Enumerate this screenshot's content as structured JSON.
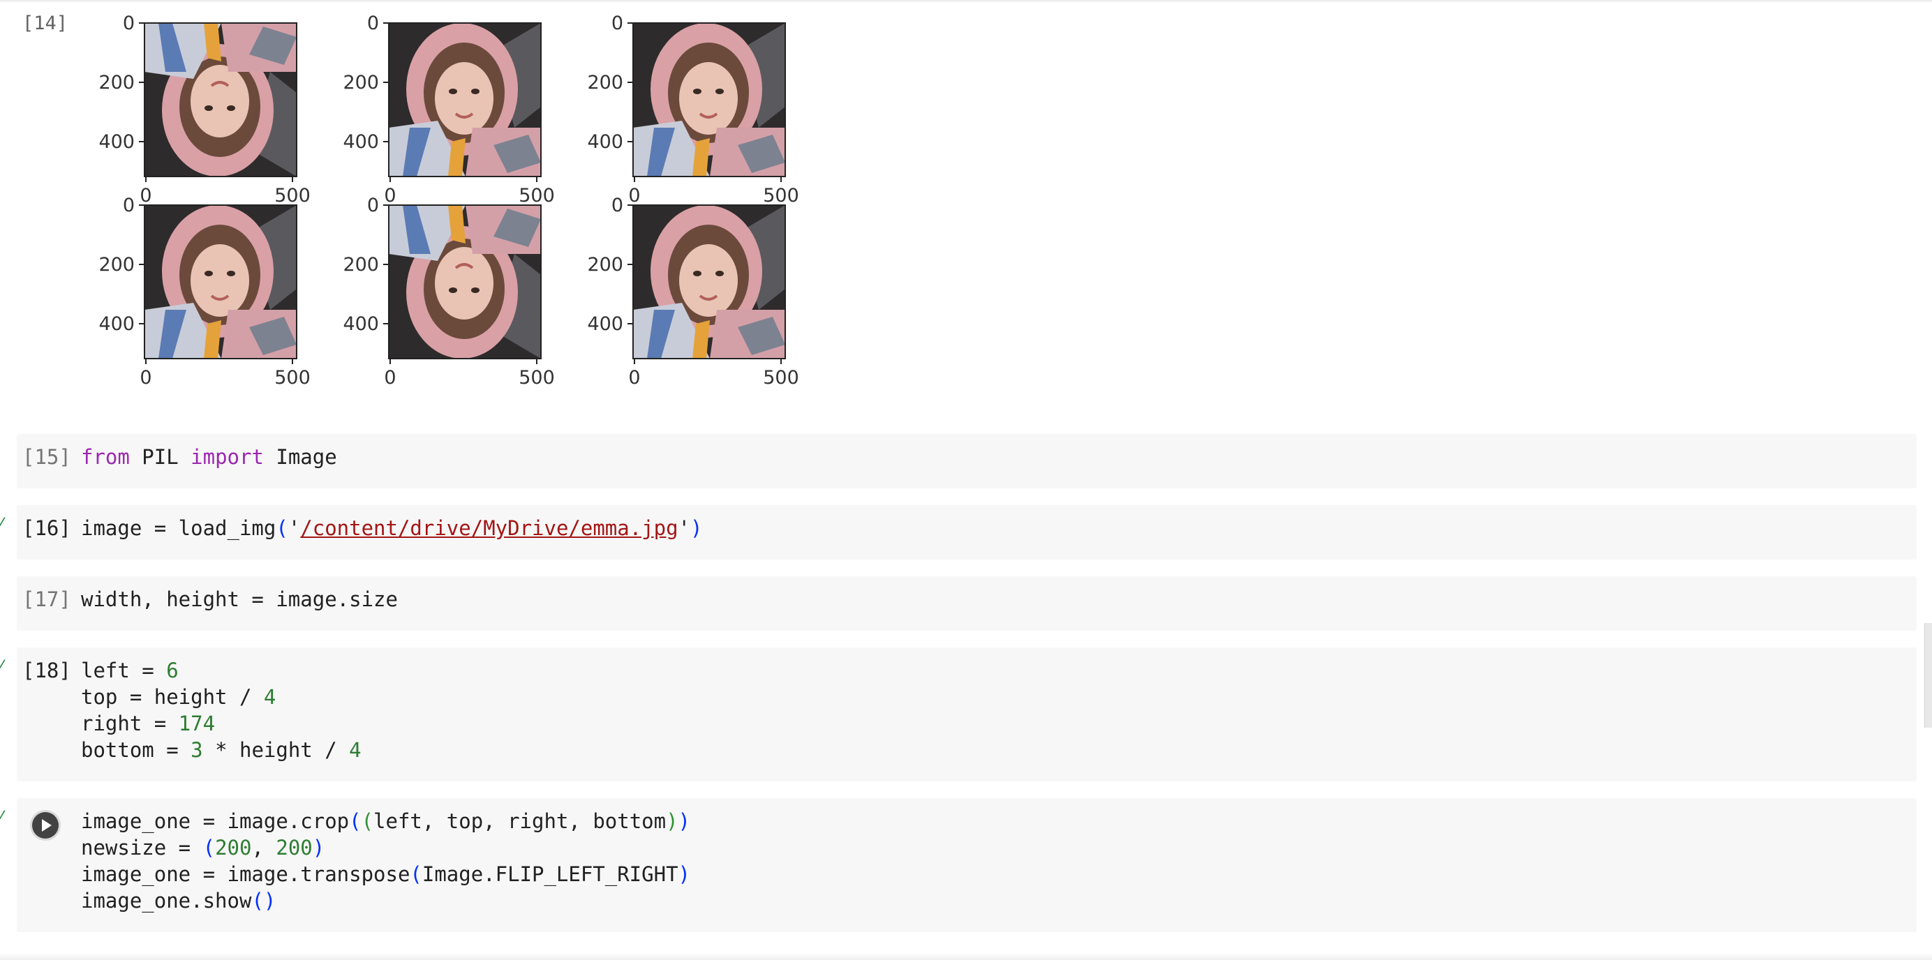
{
  "output_cell": {
    "count": "[14]",
    "subplots": {
      "y_ticks": [
        "0",
        "200",
        "400"
      ],
      "x_ticks": [
        "0",
        "500"
      ],
      "panels": [
        {
          "orientation": "flipped-vertical"
        },
        {
          "orientation": "normal"
        },
        {
          "orientation": "normal"
        },
        {
          "orientation": "normal"
        },
        {
          "orientation": "flipped-vertical"
        },
        {
          "orientation": "normal"
        }
      ]
    }
  },
  "cells": [
    {
      "count": "[15]",
      "lines": [
        [
          {
            "t": "from",
            "c": "kw"
          },
          {
            "t": " PIL "
          },
          {
            "t": "import",
            "c": "kw"
          },
          {
            "t": " Image"
          }
        ]
      ]
    },
    {
      "count": "[16]",
      "lines": [
        [
          {
            "t": "image = load_img"
          },
          {
            "t": "(",
            "c": "p1"
          },
          {
            "t": "'"
          },
          {
            "t": "/content/drive/MyDrive/emma.jpg",
            "c": "str"
          },
          {
            "t": "'"
          },
          {
            "t": ")",
            "c": "p1"
          }
        ]
      ]
    },
    {
      "count": "[17]",
      "lines": [
        [
          {
            "t": "width, height = image.size"
          }
        ]
      ]
    },
    {
      "count": "[18]",
      "lines": [
        [
          {
            "t": "left = "
          },
          {
            "t": "6",
            "c": "num"
          }
        ],
        [
          {
            "t": "top = height / "
          },
          {
            "t": "4",
            "c": "num"
          }
        ],
        [
          {
            "t": "right = "
          },
          {
            "t": "174",
            "c": "num"
          }
        ],
        [
          {
            "t": "bottom = "
          },
          {
            "t": "3",
            "c": "num"
          },
          {
            "t": " * height / "
          },
          {
            "t": "4",
            "c": "num"
          }
        ]
      ]
    },
    {
      "count": "",
      "lines": [
        [
          {
            "t": "image_one = image.crop"
          },
          {
            "t": "(",
            "c": "p1"
          },
          {
            "t": "(",
            "c": "p2"
          },
          {
            "t": "left, top, right, bottom"
          },
          {
            "t": ")",
            "c": "p2"
          },
          {
            "t": ")",
            "c": "p1"
          }
        ],
        [
          {
            "t": "newsize = "
          },
          {
            "t": "(",
            "c": "p1"
          },
          {
            "t": "200",
            "c": "num"
          },
          {
            "t": ", "
          },
          {
            "t": "200",
            "c": "num"
          },
          {
            "t": ")",
            "c": "p1"
          }
        ],
        [
          {
            "t": "image_one = image.transpose"
          },
          {
            "t": "(",
            "c": "p1"
          },
          {
            "t": "Image.FLIP_LEFT_RIGHT"
          },
          {
            "t": ")",
            "c": "p1"
          }
        ],
        [
          {
            "t": "image_one.show"
          },
          {
            "t": "()",
            "c": "p1"
          }
        ]
      ]
    }
  ],
  "colors": {
    "keyword": "#9c27b0",
    "number": "#2e7d32",
    "string": "#a31515",
    "bracket_1": "#0431fa",
    "bracket_2": "#319331",
    "cell_bg": "#f7f7f7",
    "success_check": "#188038"
  },
  "icons": {
    "run": "play-circle-icon",
    "executed": "check-icon"
  }
}
